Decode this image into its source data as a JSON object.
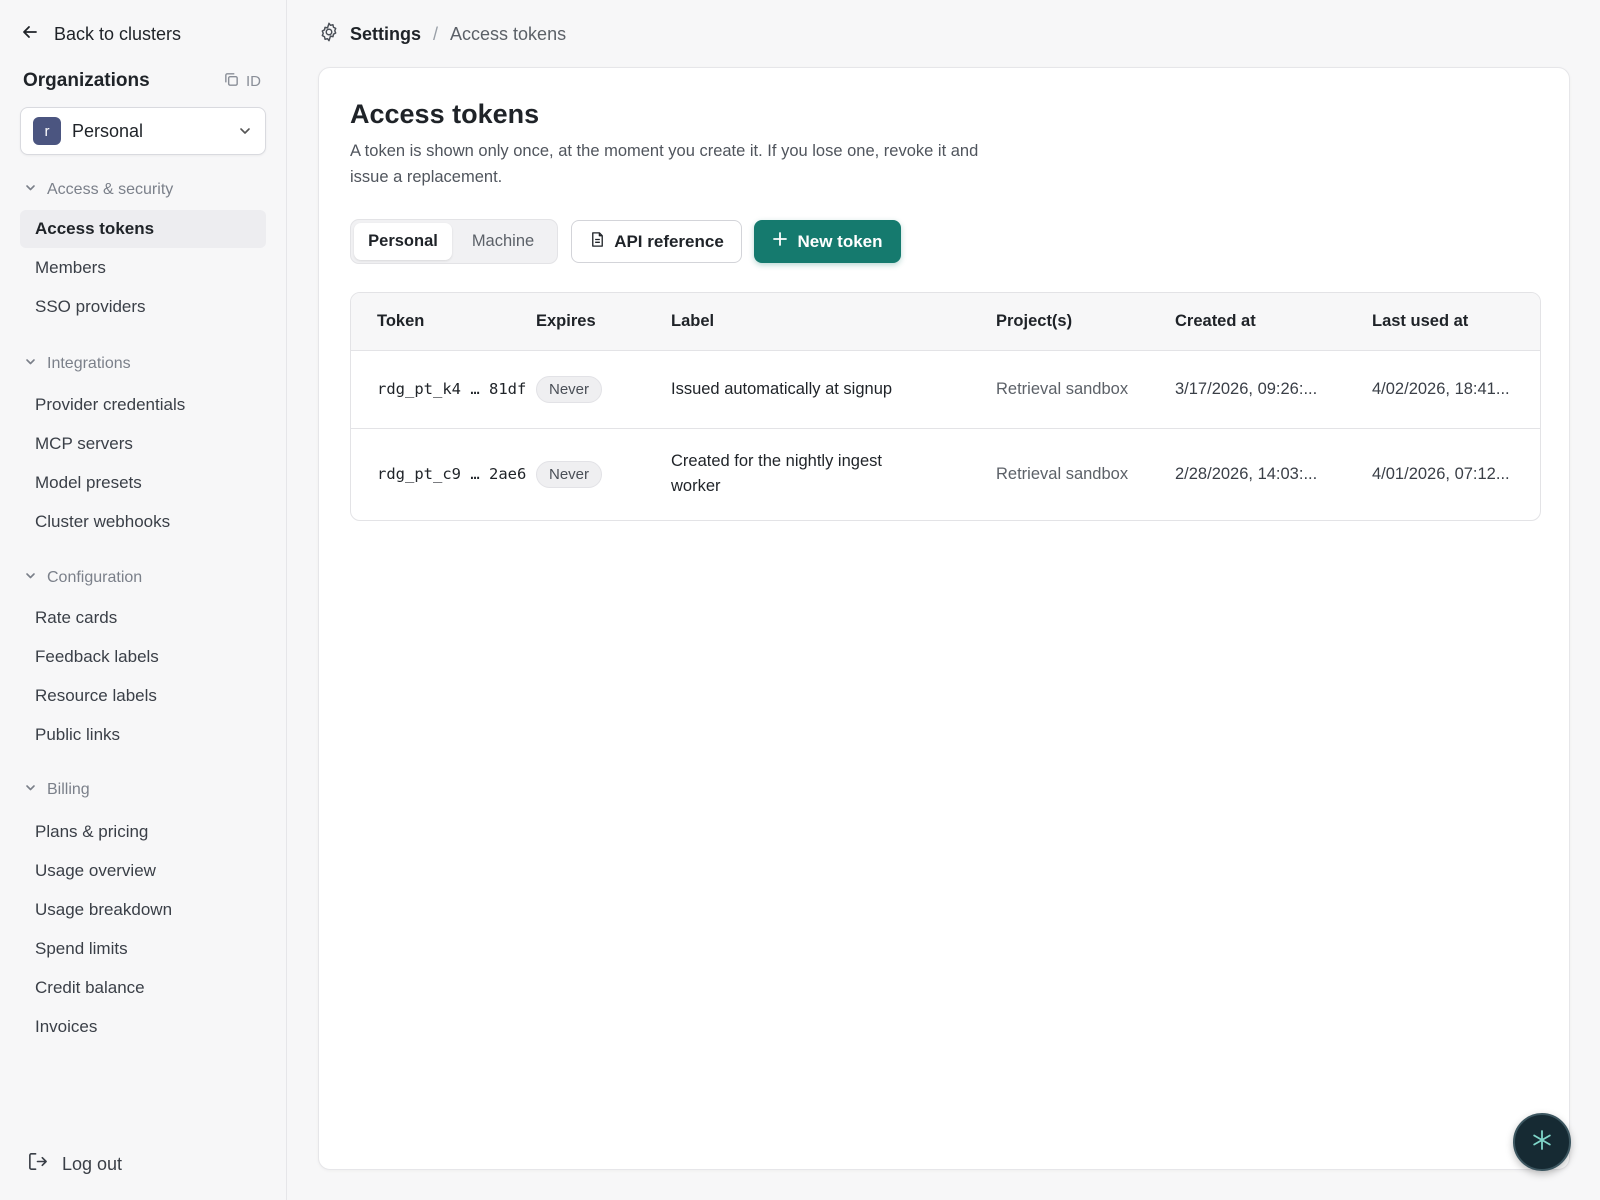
{
  "sidebar": {
    "back_label": "Back to clusters",
    "org_title": "Organizations",
    "org_id_label": "ID",
    "org_initial": "r",
    "org_name": "Personal",
    "sections": [
      {
        "title": "Access & security",
        "items": [
          "Access tokens",
          "Members",
          "SSO providers"
        ]
      },
      {
        "title": "Integrations",
        "items": [
          "Provider credentials",
          "MCP servers",
          "Model presets",
          "Cluster webhooks"
        ]
      },
      {
        "title": "Configuration",
        "items": [
          "Rate cards",
          "Feedback labels",
          "Resource labels",
          "Public links"
        ]
      },
      {
        "title": "Billing",
        "items": [
          "Plans & pricing",
          "Usage overview",
          "Usage breakdown",
          "Spend limits",
          "Credit balance",
          "Invoices"
        ]
      }
    ],
    "active_item": "Access tokens",
    "logout_label": "Log out"
  },
  "breadcrumb": {
    "root": "Settings",
    "separator": "/",
    "current": "Access tokens"
  },
  "main": {
    "title": "Access tokens",
    "description": "A token is shown only once, at the moment you create it. If you lose one, revoke it and issue a replacement.",
    "tabs": [
      {
        "label": "Personal",
        "selected": true
      },
      {
        "label": "Machine",
        "selected": false
      }
    ],
    "api_reference_label": "API reference",
    "new_token_label": "New token",
    "accent_color": "#157a6e"
  },
  "table": {
    "columns": [
      "Token",
      "Expires",
      "Label",
      "Project(s)",
      "Created at",
      "Last used at"
    ],
    "rows": [
      {
        "token": "rdg_pt_k4 … 81df",
        "expires": "Never",
        "label": "Issued automatically at signup",
        "project": "Retrieval sandbox",
        "created": "3/17/2026, 09:26:...",
        "last_used": "4/02/2026, 18:41..."
      },
      {
        "token": "rdg_pt_c9 … 2ae6",
        "expires": "Never",
        "label": "Created for the nightly ingest worker",
        "project": "Retrieval sandbox",
        "created": "2/28/2026, 14:03:...",
        "last_used": "4/01/2026, 07:12..."
      }
    ]
  },
  "icons": {
    "back": "arrow-left-icon",
    "copy": "copy-icon",
    "chevron": "chevron-down-icon",
    "settings": "gear-icon",
    "doc": "document-icon",
    "plus": "plus-icon",
    "logout": "logout-icon",
    "assistant": "sparkle-icon"
  }
}
